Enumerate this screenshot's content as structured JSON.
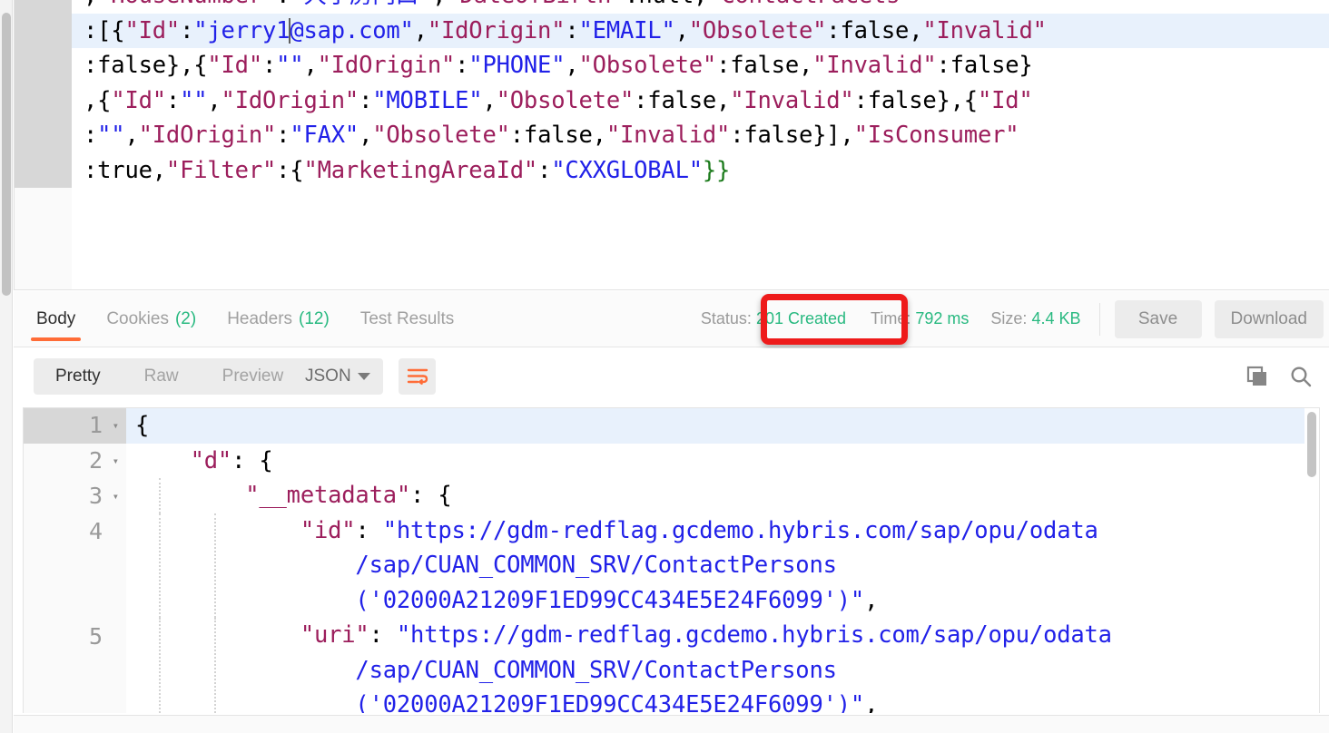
{
  "request_editor": {
    "name": "request-body-editor",
    "language": "json",
    "cursor_after": "jerry1",
    "lines": [
      {
        "clipped": true,
        "highlighted": false,
        "tokens": [
          {
            "t": ",",
            "c": "p"
          },
          {
            "t": "\"HouseNumber\"",
            "c": "k"
          },
          {
            "t": ":",
            "c": "p"
          },
          {
            "t": "\"大小房门口\"",
            "c": "s"
          },
          {
            "t": ",",
            "c": "p"
          },
          {
            "t": "\"DateOfBirth\"",
            "c": "k"
          },
          {
            "t": ":",
            "c": "p"
          },
          {
            "t": "null",
            "c": "p"
          },
          {
            "t": ",",
            "c": "p"
          },
          {
            "t": "\"ContactFacets\"",
            "c": "k"
          }
        ]
      },
      {
        "clipped": false,
        "highlighted": true,
        "tokens": [
          {
            "t": ":[{",
            "c": "p"
          },
          {
            "t": "\"Id\"",
            "c": "k"
          },
          {
            "t": ":",
            "c": "p"
          },
          {
            "t": "\"jerry1",
            "c": "s"
          },
          {
            "t": "CARET",
            "c": "caret"
          },
          {
            "t": "@sap.com\"",
            "c": "s"
          },
          {
            "t": ",",
            "c": "p"
          },
          {
            "t": "\"IdOrigin\"",
            "c": "k"
          },
          {
            "t": ":",
            "c": "p"
          },
          {
            "t": "\"EMAIL\"",
            "c": "s"
          },
          {
            "t": ",",
            "c": "p"
          },
          {
            "t": "\"Obsolete\"",
            "c": "k"
          },
          {
            "t": ":false,",
            "c": "p"
          },
          {
            "t": "\"Invalid\"",
            "c": "k"
          }
        ]
      },
      {
        "clipped": false,
        "highlighted": false,
        "tokens": [
          {
            "t": ":false},{",
            "c": "p"
          },
          {
            "t": "\"Id\"",
            "c": "k"
          },
          {
            "t": ":",
            "c": "p"
          },
          {
            "t": "\"\"",
            "c": "s"
          },
          {
            "t": ",",
            "c": "p"
          },
          {
            "t": "\"IdOrigin\"",
            "c": "k"
          },
          {
            "t": ":",
            "c": "p"
          },
          {
            "t": "\"PHONE\"",
            "c": "s"
          },
          {
            "t": ",",
            "c": "p"
          },
          {
            "t": "\"Obsolete\"",
            "c": "k"
          },
          {
            "t": ":false,",
            "c": "p"
          },
          {
            "t": "\"Invalid\"",
            "c": "k"
          },
          {
            "t": ":false}",
            "c": "p"
          }
        ]
      },
      {
        "clipped": false,
        "highlighted": false,
        "tokens": [
          {
            "t": ",{",
            "c": "p"
          },
          {
            "t": "\"Id\"",
            "c": "k"
          },
          {
            "t": ":",
            "c": "p"
          },
          {
            "t": "\"\"",
            "c": "s"
          },
          {
            "t": ",",
            "c": "p"
          },
          {
            "t": "\"IdOrigin\"",
            "c": "k"
          },
          {
            "t": ":",
            "c": "p"
          },
          {
            "t": "\"MOBILE\"",
            "c": "s"
          },
          {
            "t": ",",
            "c": "p"
          },
          {
            "t": "\"Obsolete\"",
            "c": "k"
          },
          {
            "t": ":false,",
            "c": "p"
          },
          {
            "t": "\"Invalid\"",
            "c": "k"
          },
          {
            "t": ":false},{",
            "c": "p"
          },
          {
            "t": "\"Id\"",
            "c": "k"
          }
        ]
      },
      {
        "clipped": false,
        "highlighted": false,
        "tokens": [
          {
            "t": ":",
            "c": "p"
          },
          {
            "t": "\"\"",
            "c": "s"
          },
          {
            "t": ",",
            "c": "p"
          },
          {
            "t": "\"IdOrigin\"",
            "c": "k"
          },
          {
            "t": ":",
            "c": "p"
          },
          {
            "t": "\"FAX\"",
            "c": "s"
          },
          {
            "t": ",",
            "c": "p"
          },
          {
            "t": "\"Obsolete\"",
            "c": "k"
          },
          {
            "t": ":false,",
            "c": "p"
          },
          {
            "t": "\"Invalid\"",
            "c": "k"
          },
          {
            "t": ":false}],",
            "c": "p"
          },
          {
            "t": "\"IsConsumer\"",
            "c": "k"
          }
        ]
      },
      {
        "clipped": false,
        "highlighted": false,
        "tokens": [
          {
            "t": ":true,",
            "c": "p"
          },
          {
            "t": "\"Filter\"",
            "c": "k"
          },
          {
            "t": ":{",
            "c": "p"
          },
          {
            "t": "\"MarketingAreaId\"",
            "c": "k"
          },
          {
            "t": ":",
            "c": "p"
          },
          {
            "t": "\"CXXGLOBAL\"",
            "c": "s"
          },
          {
            "t": "}}",
            "c": "gb"
          }
        ]
      }
    ]
  },
  "response_tabs": [
    {
      "label": "Body",
      "count": null,
      "active": true
    },
    {
      "label": "Cookies",
      "count": "(2)",
      "active": false
    },
    {
      "label": "Headers",
      "count": "(12)",
      "active": false
    },
    {
      "label": "Test Results",
      "count": null,
      "active": false
    }
  ],
  "response_meta": {
    "status_label": "Status:",
    "status_value": "201 Created",
    "time_label": "Time:",
    "time_value": "792 ms",
    "size_label": "Size:",
    "size_value": "4.4 KB",
    "save_label": "Save",
    "download_label": "Download",
    "highlight_color": "#ee1b1b",
    "value_color": "#28b980"
  },
  "format_toolbar": {
    "views": [
      {
        "label": "Pretty",
        "active": true
      },
      {
        "label": "Raw",
        "active": false
      },
      {
        "label": "Preview",
        "active": false
      }
    ],
    "language_selected": "JSON",
    "wrap_icon": "wrap-lines-icon",
    "wrap_color": "#ff6c37",
    "copy_icon": "copy-icon",
    "search_icon": "search-icon"
  },
  "response_body": {
    "name": "response-body-json",
    "lines": [
      {
        "number": "1",
        "fold": true,
        "highlighted": true,
        "guides": 0,
        "segments": [
          {
            "t": "{",
            "c": "p"
          }
        ]
      },
      {
        "number": "2",
        "fold": true,
        "highlighted": false,
        "guides": 0,
        "segments": [
          {
            "t": "    ",
            "c": "p"
          },
          {
            "t": "\"d\"",
            "c": "rk"
          },
          {
            "t": ": {",
            "c": "p"
          }
        ]
      },
      {
        "number": "3",
        "fold": true,
        "highlighted": false,
        "guides": 1,
        "segments": [
          {
            "t": "        ",
            "c": "p"
          },
          {
            "t": "\"__metadata\"",
            "c": "rk"
          },
          {
            "t": ": {",
            "c": "p"
          }
        ]
      },
      {
        "number": "4",
        "fold": false,
        "highlighted": false,
        "guides": 2,
        "segments": [
          {
            "t": "            ",
            "c": "p"
          },
          {
            "t": "\"id\"",
            "c": "rk"
          },
          {
            "t": ": ",
            "c": "p"
          },
          {
            "t": "\"https://gdm-redflag.gcdemo.hybris.com/sap/opu/odata\n                /sap/CUAN_COMMON_SRV/ContactPersons\n                ('02000A21209F1ED99CC434E5E24F6099')\"",
            "c": "rs"
          },
          {
            "t": ",",
            "c": "p"
          }
        ]
      },
      {
        "number": "5",
        "fold": false,
        "highlighted": false,
        "guides": 2,
        "segments": [
          {
            "t": "            ",
            "c": "p"
          },
          {
            "t": "\"uri\"",
            "c": "rk"
          },
          {
            "t": ": ",
            "c": "p"
          },
          {
            "t": "\"https://gdm-redflag.gcdemo.hybris.com/sap/opu/odata\n                /sap/CUAN_COMMON_SRV/ContactPersons\n                ('02000A21209F1ED99CC434E5E24F6099')\"",
            "c": "rs"
          },
          {
            "t": ",",
            "c": "p"
          }
        ]
      }
    ]
  }
}
